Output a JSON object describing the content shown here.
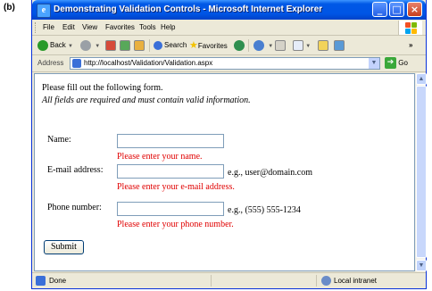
{
  "figure_label": "(b)",
  "window": {
    "title": "Demonstrating Validation Controls - Microsoft Internet Explorer",
    "icon": "ie-icon",
    "controls": {
      "minimize": "_",
      "maximize": "□",
      "close": "×"
    }
  },
  "menubar": {
    "items": [
      "File",
      "Edit",
      "View",
      "Favorites",
      "Tools",
      "Help"
    ]
  },
  "toolbar": {
    "back_label": "Back",
    "search_label": "Search",
    "favorites_label": "Favorites",
    "overflow_label": "»",
    "colors": {
      "back": "#2a9a2a",
      "forward": "#9aa0a6",
      "search": "#3a6fd8",
      "favorites": "#f2c200"
    }
  },
  "address": {
    "label": "Address",
    "url": "http://localhost/Validation/Validation.aspx",
    "go_label": "Go"
  },
  "form": {
    "intro": "Please fill out the following form.",
    "intro_em": "All fields are required and must contain valid information.",
    "fields": [
      {
        "label": "Name:",
        "value": "",
        "hint": "",
        "error": "Please enter your name."
      },
      {
        "label": "E-mail address:",
        "value": "",
        "hint": "e.g., user@domain.com",
        "error": "Please enter your e-mail address."
      },
      {
        "label": "Phone number:",
        "value": "",
        "hint": "e.g., (555) 555-1234",
        "error": "Please enter your phone number."
      }
    ],
    "submit_label": "Submit",
    "error_color": "#e00000"
  },
  "statusbar": {
    "status": "Done",
    "zone": "Local intranet"
  }
}
